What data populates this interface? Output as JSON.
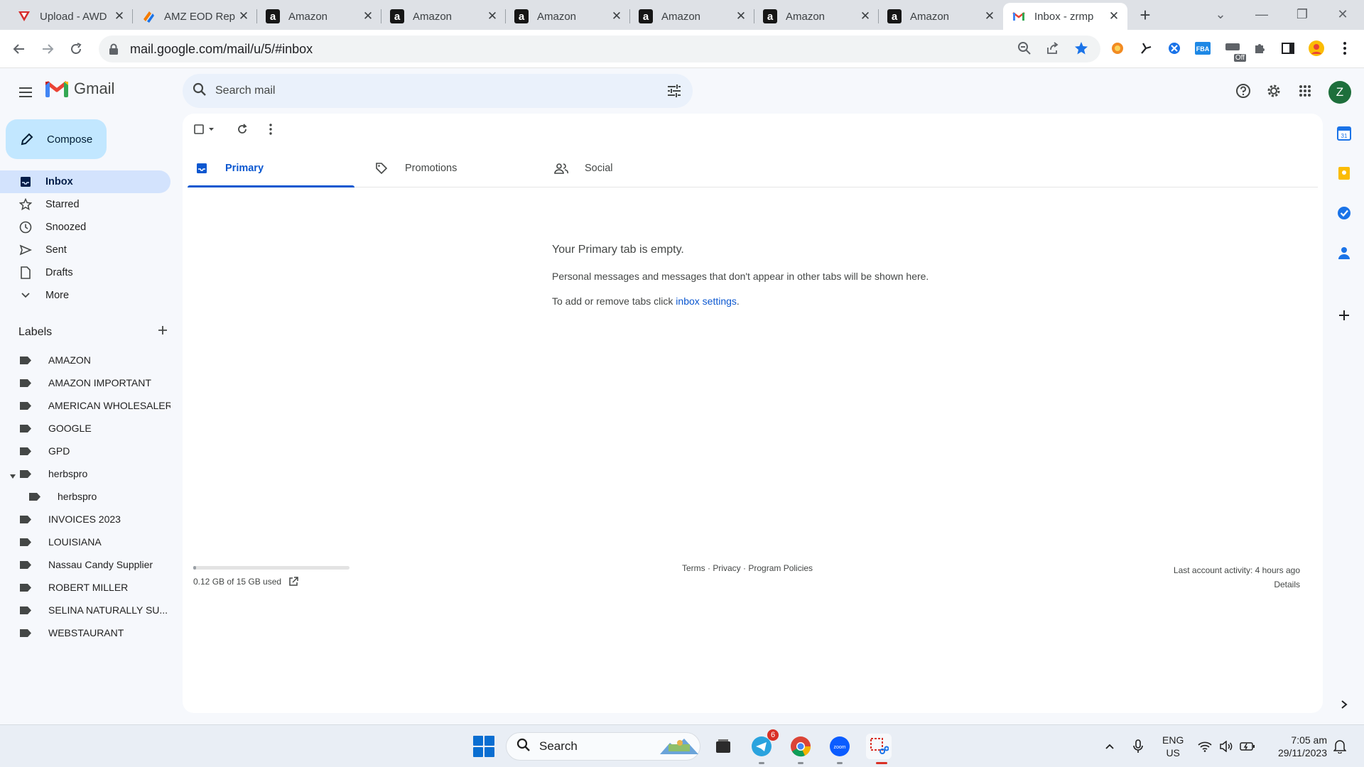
{
  "browser": {
    "tabs": [
      {
        "title": "Upload - AWD",
        "favicon": "awd-logo-icon"
      },
      {
        "title": "AMZ EOD Rep",
        "favicon": "app-logo-icon"
      },
      {
        "title": "Amazon",
        "favicon": "amazon-icon"
      },
      {
        "title": "Amazon",
        "favicon": "amazon-icon"
      },
      {
        "title": "Amazon",
        "favicon": "amazon-icon"
      },
      {
        "title": "Amazon",
        "favicon": "amazon-icon"
      },
      {
        "title": "Amazon",
        "favicon": "amazon-icon"
      },
      {
        "title": "Amazon",
        "favicon": "amazon-icon"
      },
      {
        "title": "Inbox - zrmp",
        "favicon": "gmail-icon",
        "active": true
      }
    ],
    "amazon_letter": "a",
    "url": "mail.google.com/mail/u/5/#inbox",
    "extension_badge": "Off"
  },
  "gmail": {
    "logo_text": "Gmail",
    "search_placeholder": "Search mail",
    "avatar_letter": "Z",
    "compose_label": "Compose",
    "nav": [
      {
        "label": "Inbox",
        "icon": "inbox-icon",
        "active": true
      },
      {
        "label": "Starred",
        "icon": "star-icon"
      },
      {
        "label": "Snoozed",
        "icon": "clock-icon"
      },
      {
        "label": "Sent",
        "icon": "send-icon"
      },
      {
        "label": "Drafts",
        "icon": "draft-icon"
      },
      {
        "label": "More",
        "icon": "chevron-down-icon"
      }
    ],
    "labels_title": "Labels",
    "labels": [
      {
        "name": "AMAZON"
      },
      {
        "name": "AMAZON IMPORTANT"
      },
      {
        "name": "AMERICAN WHOLESALER"
      },
      {
        "name": "GOOGLE"
      },
      {
        "name": "GPD"
      },
      {
        "name": "herbspro",
        "expanded": true
      },
      {
        "name": "herbspro",
        "child": true
      },
      {
        "name": "INVOICES 2023"
      },
      {
        "name": "LOUISIANA"
      },
      {
        "name": "Nassau Candy Supplier"
      },
      {
        "name": "ROBERT MILLER"
      },
      {
        "name": "SELINA NATURALLY SU..."
      },
      {
        "name": "WEBSTAURANT"
      }
    ],
    "categories": [
      {
        "label": "Primary",
        "icon": "inbox-icon",
        "active": true
      },
      {
        "label": "Promotions",
        "icon": "tag-icon"
      },
      {
        "label": "Social",
        "icon": "people-icon"
      }
    ],
    "empty": {
      "title": "Your Primary tab is empty.",
      "description": "Personal messages and messages that don't appear in other tabs will be shown here.",
      "hint_prefix": "To add or remove tabs click ",
      "hint_link": "inbox settings",
      "hint_suffix": "."
    },
    "storage": {
      "text": "0.12 GB of 15 GB used",
      "fraction_used": 0.008
    },
    "footer": {
      "terms": "Terms",
      "privacy": "Privacy",
      "policies": "Program Policies",
      "separator": " · "
    },
    "activity": {
      "text": "Last account activity: 4 hours ago",
      "details": "Details"
    }
  },
  "taskbar": {
    "search_label": "Search",
    "telegram_badge": "6",
    "lang_line1": "ENG",
    "lang_line2": "US",
    "time": "7:05 am",
    "date": "29/11/2023",
    "zoom_label": "zoom"
  },
  "colors": {
    "accent": "#0b57d0",
    "compose_bg": "#c2e7ff",
    "nav_active_bg": "#d3e3fd",
    "search_bg": "#eaf1fb",
    "avatar_bg": "#1e6f3c",
    "gmail_red": "#ea4335"
  }
}
